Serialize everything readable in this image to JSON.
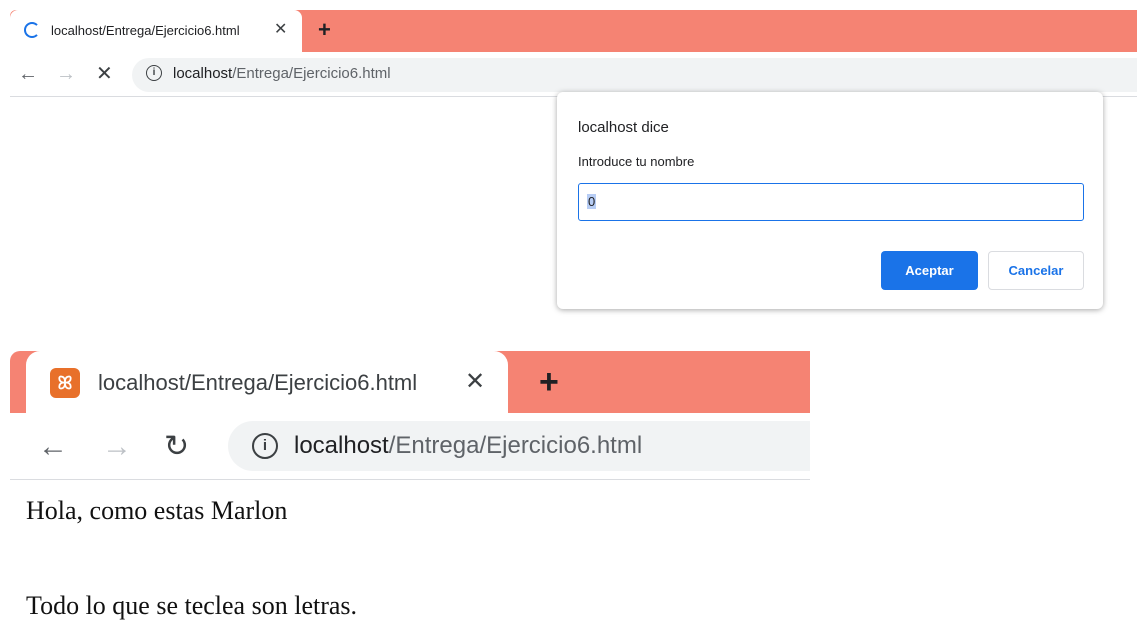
{
  "top_browser": {
    "tab_title": "localhost/Entrega/Ejercicio6.html",
    "tab_close": "✕",
    "new_tab": "+",
    "back": "←",
    "forward": "→",
    "stop": "✕",
    "info": "i",
    "url_host": "localhost",
    "url_path": "/Entrega/Ejercicio6.html",
    "tab_bar_color": "#f58373"
  },
  "dialog": {
    "title": "localhost dice",
    "message": "Introduce tu nombre",
    "input_value": "0",
    "accept_label": "Aceptar",
    "cancel_label": "Cancelar",
    "accent_color": "#1a73e8"
  },
  "bottom_browser": {
    "tab_title": "localhost/Entrega/Ejercicio6.html",
    "favicon": "ꕤ",
    "tab_close": "✕",
    "new_tab": "+",
    "back": "←",
    "forward": "→",
    "reload": "↻",
    "info": "i",
    "url_host": "localhost",
    "url_path": "/Entrega/Ejercicio6.html"
  },
  "page_content": {
    "greeting": "Hola, como estas Marlon",
    "result": "Todo lo que se teclea son letras."
  }
}
